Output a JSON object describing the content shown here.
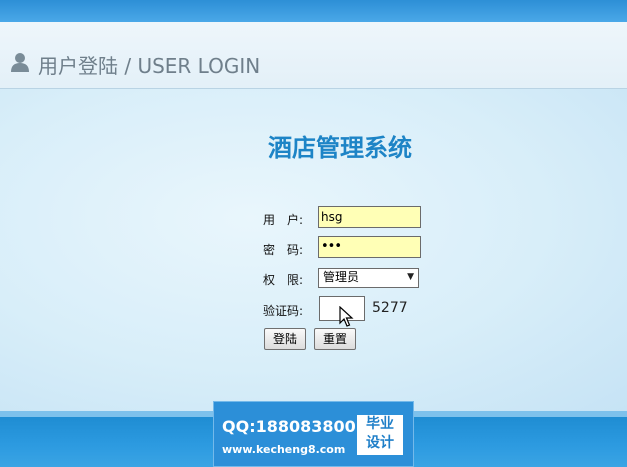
{
  "header": {
    "title": "用户登陆 / USER LOGIN"
  },
  "system_title": "酒店管理系统",
  "form": {
    "user_label": "用　户:",
    "user_value": "hsg",
    "password_label": "密　码:",
    "password_value": "•••",
    "role_label": "权　限:",
    "role_value": "管理员",
    "captcha_label": "验证码:",
    "captcha_value": "",
    "captcha_code": "5277",
    "login_button": "登陆",
    "reset_button": "重置"
  },
  "watermark": {
    "qq": "QQ:188083800",
    "url": "www.kecheng8.com",
    "box_line1": "毕业",
    "box_line2": "设计"
  },
  "colors": {
    "accent": "#1d84c6",
    "input_highlight": "#ffffb6",
    "top_bar": "#2d8fd6"
  },
  "icons": [
    "user-icon",
    "dropdown-arrow-icon",
    "mouse-cursor-icon"
  ]
}
